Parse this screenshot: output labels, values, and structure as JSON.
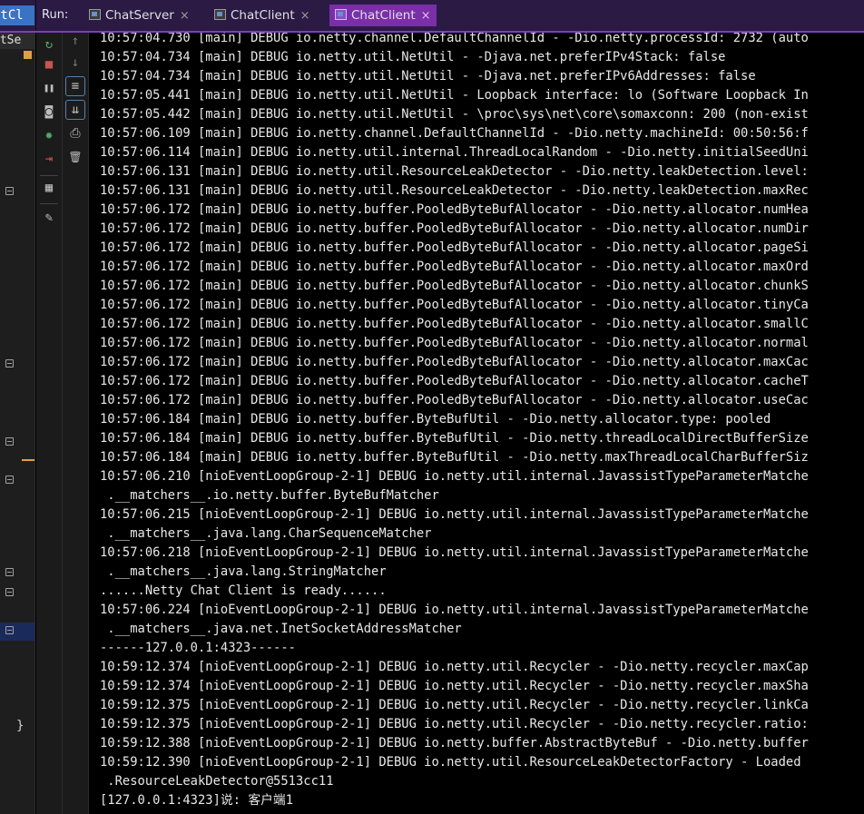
{
  "tabbar": {
    "left_stub": "atCl",
    "run_label": "Run:",
    "tabs": [
      {
        "label": "ChatServer",
        "close": "×",
        "active": false
      },
      {
        "label": "ChatClient",
        "close": "×",
        "active": false
      },
      {
        "label": "ChatClient",
        "close": "×",
        "active": true
      }
    ]
  },
  "editor": {
    "strip_label": "atSe",
    "brace": "}"
  },
  "toolbar": {
    "column1": [
      {
        "icon": "rerun-icon",
        "glyph": "↻",
        "color": "#59a869"
      },
      {
        "icon": "stop-icon",
        "glyph": "■",
        "color": "#c75450"
      },
      {
        "icon": "pause-icon",
        "glyph": "❚❚",
        "color": "#bdbdbd"
      },
      {
        "icon": "camera-icon",
        "glyph": "◙",
        "color": "#bdbdbd"
      },
      {
        "icon": "debug-bug-icon",
        "glyph": "✹",
        "color": "#59a869"
      },
      {
        "icon": "exit-icon",
        "glyph": "⇥",
        "color": "#c75450"
      },
      {
        "icon": "layout-icon",
        "glyph": "▦",
        "color": "#bdbdbd"
      },
      {
        "icon": "pin-icon",
        "glyph": "✎",
        "color": "#bdbdbd"
      }
    ],
    "column2": [
      {
        "icon": "arrow-up-icon",
        "glyph": "↑",
        "color": "#7a7a7a"
      },
      {
        "icon": "arrow-down-icon",
        "glyph": "↓",
        "color": "#7a7a7a"
      },
      {
        "icon": "soft-wrap-icon",
        "glyph": "≡",
        "color": "#bdbdbd"
      },
      {
        "icon": "scroll-to-end-icon",
        "glyph": "⇊",
        "color": "#bdbdbd"
      },
      {
        "icon": "print-icon",
        "glyph": "⎙",
        "color": "#bdbdbd"
      },
      {
        "icon": "trash-icon",
        "glyph": "🗑",
        "color": "#bdbdbd"
      }
    ]
  },
  "console": {
    "lines": [
      "10:57:04.730 [main] DEBUG io.netty.channel.DefaultChannelId - -Dio.netty.processId: 2732 (auto",
      "10:57:04.734 [main] DEBUG io.netty.util.NetUtil - -Djava.net.preferIPv4Stack: false",
      "10:57:04.734 [main] DEBUG io.netty.util.NetUtil - -Djava.net.preferIPv6Addresses: false",
      "10:57:05.441 [main] DEBUG io.netty.util.NetUtil - Loopback interface: lo (Software Loopback In",
      "10:57:05.442 [main] DEBUG io.netty.util.NetUtil - \\proc\\sys\\net\\core\\somaxconn: 200 (non-exist",
      "10:57:06.109 [main] DEBUG io.netty.channel.DefaultChannelId - -Dio.netty.machineId: 00:50:56:f",
      "10:57:06.114 [main] DEBUG io.netty.util.internal.ThreadLocalRandom - -Dio.netty.initialSeedUni",
      "10:57:06.131 [main] DEBUG io.netty.util.ResourceLeakDetector - -Dio.netty.leakDetection.level:",
      "10:57:06.131 [main] DEBUG io.netty.util.ResourceLeakDetector - -Dio.netty.leakDetection.maxRec",
      "10:57:06.172 [main] DEBUG io.netty.buffer.PooledByteBufAllocator - -Dio.netty.allocator.numHea",
      "10:57:06.172 [main] DEBUG io.netty.buffer.PooledByteBufAllocator - -Dio.netty.allocator.numDir",
      "10:57:06.172 [main] DEBUG io.netty.buffer.PooledByteBufAllocator - -Dio.netty.allocator.pageSi",
      "10:57:06.172 [main] DEBUG io.netty.buffer.PooledByteBufAllocator - -Dio.netty.allocator.maxOrd",
      "10:57:06.172 [main] DEBUG io.netty.buffer.PooledByteBufAllocator - -Dio.netty.allocator.chunkS",
      "10:57:06.172 [main] DEBUG io.netty.buffer.PooledByteBufAllocator - -Dio.netty.allocator.tinyCa",
      "10:57:06.172 [main] DEBUG io.netty.buffer.PooledByteBufAllocator - -Dio.netty.allocator.smallC",
      "10:57:06.172 [main] DEBUG io.netty.buffer.PooledByteBufAllocator - -Dio.netty.allocator.normal",
      "10:57:06.172 [main] DEBUG io.netty.buffer.PooledByteBufAllocator - -Dio.netty.allocator.maxCac",
      "10:57:06.172 [main] DEBUG io.netty.buffer.PooledByteBufAllocator - -Dio.netty.allocator.cacheT",
      "10:57:06.172 [main] DEBUG io.netty.buffer.PooledByteBufAllocator - -Dio.netty.allocator.useCac",
      "10:57:06.184 [main] DEBUG io.netty.buffer.ByteBufUtil - -Dio.netty.allocator.type: pooled",
      "10:57:06.184 [main] DEBUG io.netty.buffer.ByteBufUtil - -Dio.netty.threadLocalDirectBufferSize",
      "10:57:06.184 [main] DEBUG io.netty.buffer.ByteBufUtil - -Dio.netty.maxThreadLocalCharBufferSiz",
      "10:57:06.210 [nioEventLoopGroup-2-1] DEBUG io.netty.util.internal.JavassistTypeParameterMatche",
      " .__matchers__.io.netty.buffer.ByteBufMatcher",
      "10:57:06.215 [nioEventLoopGroup-2-1] DEBUG io.netty.util.internal.JavassistTypeParameterMatche",
      " .__matchers__.java.lang.CharSequenceMatcher",
      "10:57:06.218 [nioEventLoopGroup-2-1] DEBUG io.netty.util.internal.JavassistTypeParameterMatche",
      " .__matchers__.java.lang.StringMatcher",
      "......Netty Chat Client is ready......",
      "10:57:06.224 [nioEventLoopGroup-2-1] DEBUG io.netty.util.internal.JavassistTypeParameterMatche",
      " .__matchers__.java.net.InetSocketAddressMatcher",
      "------127.0.0.1:4323------",
      "10:59:12.374 [nioEventLoopGroup-2-1] DEBUG io.netty.util.Recycler - -Dio.netty.recycler.maxCap",
      "10:59:12.374 [nioEventLoopGroup-2-1] DEBUG io.netty.util.Recycler - -Dio.netty.recycler.maxSha",
      "10:59:12.375 [nioEventLoopGroup-2-1] DEBUG io.netty.util.Recycler - -Dio.netty.recycler.linkCa",
      "10:59:12.375 [nioEventLoopGroup-2-1] DEBUG io.netty.util.Recycler - -Dio.netty.recycler.ratio:",
      "10:59:12.388 [nioEventLoopGroup-2-1] DEBUG io.netty.buffer.AbstractByteBuf - -Dio.netty.buffer",
      "10:59:12.390 [nioEventLoopGroup-2-1] DEBUG io.netty.util.ResourceLeakDetectorFactory - Loaded",
      " .ResourceLeakDetector@5513cc11",
      "[127.0.0.1:4323]说: 客户端1"
    ]
  },
  "colors": {
    "tabbar_bg": "#2a1a44",
    "active_tab": "#7a2fa8",
    "console_bg": "#000000",
    "console_text": "#e8e8e8"
  }
}
